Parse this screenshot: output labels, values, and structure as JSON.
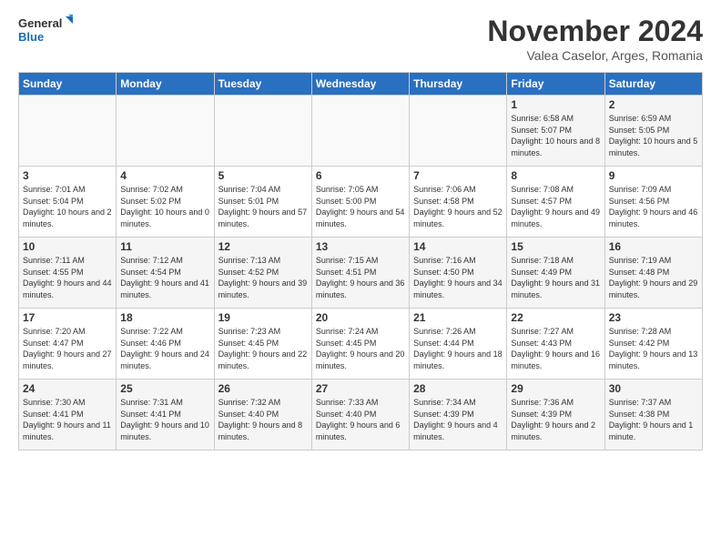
{
  "logo": {
    "text_general": "General",
    "text_blue": "Blue"
  },
  "header": {
    "month_title": "November 2024",
    "location": "Valea Caselor, Arges, Romania"
  },
  "weekdays": [
    "Sunday",
    "Monday",
    "Tuesday",
    "Wednesday",
    "Thursday",
    "Friday",
    "Saturday"
  ],
  "weeks": [
    [
      {
        "day": "",
        "info": ""
      },
      {
        "day": "",
        "info": ""
      },
      {
        "day": "",
        "info": ""
      },
      {
        "day": "",
        "info": ""
      },
      {
        "day": "",
        "info": ""
      },
      {
        "day": "1",
        "info": "Sunrise: 6:58 AM\nSunset: 5:07 PM\nDaylight: 10 hours and 8 minutes."
      },
      {
        "day": "2",
        "info": "Sunrise: 6:59 AM\nSunset: 5:05 PM\nDaylight: 10 hours and 5 minutes."
      }
    ],
    [
      {
        "day": "3",
        "info": "Sunrise: 7:01 AM\nSunset: 5:04 PM\nDaylight: 10 hours and 2 minutes."
      },
      {
        "day": "4",
        "info": "Sunrise: 7:02 AM\nSunset: 5:02 PM\nDaylight: 10 hours and 0 minutes."
      },
      {
        "day": "5",
        "info": "Sunrise: 7:04 AM\nSunset: 5:01 PM\nDaylight: 9 hours and 57 minutes."
      },
      {
        "day": "6",
        "info": "Sunrise: 7:05 AM\nSunset: 5:00 PM\nDaylight: 9 hours and 54 minutes."
      },
      {
        "day": "7",
        "info": "Sunrise: 7:06 AM\nSunset: 4:58 PM\nDaylight: 9 hours and 52 minutes."
      },
      {
        "day": "8",
        "info": "Sunrise: 7:08 AM\nSunset: 4:57 PM\nDaylight: 9 hours and 49 minutes."
      },
      {
        "day": "9",
        "info": "Sunrise: 7:09 AM\nSunset: 4:56 PM\nDaylight: 9 hours and 46 minutes."
      }
    ],
    [
      {
        "day": "10",
        "info": "Sunrise: 7:11 AM\nSunset: 4:55 PM\nDaylight: 9 hours and 44 minutes."
      },
      {
        "day": "11",
        "info": "Sunrise: 7:12 AM\nSunset: 4:54 PM\nDaylight: 9 hours and 41 minutes."
      },
      {
        "day": "12",
        "info": "Sunrise: 7:13 AM\nSunset: 4:52 PM\nDaylight: 9 hours and 39 minutes."
      },
      {
        "day": "13",
        "info": "Sunrise: 7:15 AM\nSunset: 4:51 PM\nDaylight: 9 hours and 36 minutes."
      },
      {
        "day": "14",
        "info": "Sunrise: 7:16 AM\nSunset: 4:50 PM\nDaylight: 9 hours and 34 minutes."
      },
      {
        "day": "15",
        "info": "Sunrise: 7:18 AM\nSunset: 4:49 PM\nDaylight: 9 hours and 31 minutes."
      },
      {
        "day": "16",
        "info": "Sunrise: 7:19 AM\nSunset: 4:48 PM\nDaylight: 9 hours and 29 minutes."
      }
    ],
    [
      {
        "day": "17",
        "info": "Sunrise: 7:20 AM\nSunset: 4:47 PM\nDaylight: 9 hours and 27 minutes."
      },
      {
        "day": "18",
        "info": "Sunrise: 7:22 AM\nSunset: 4:46 PM\nDaylight: 9 hours and 24 minutes."
      },
      {
        "day": "19",
        "info": "Sunrise: 7:23 AM\nSunset: 4:45 PM\nDaylight: 9 hours and 22 minutes."
      },
      {
        "day": "20",
        "info": "Sunrise: 7:24 AM\nSunset: 4:45 PM\nDaylight: 9 hours and 20 minutes."
      },
      {
        "day": "21",
        "info": "Sunrise: 7:26 AM\nSunset: 4:44 PM\nDaylight: 9 hours and 18 minutes."
      },
      {
        "day": "22",
        "info": "Sunrise: 7:27 AM\nSunset: 4:43 PM\nDaylight: 9 hours and 16 minutes."
      },
      {
        "day": "23",
        "info": "Sunrise: 7:28 AM\nSunset: 4:42 PM\nDaylight: 9 hours and 13 minutes."
      }
    ],
    [
      {
        "day": "24",
        "info": "Sunrise: 7:30 AM\nSunset: 4:41 PM\nDaylight: 9 hours and 11 minutes."
      },
      {
        "day": "25",
        "info": "Sunrise: 7:31 AM\nSunset: 4:41 PM\nDaylight: 9 hours and 10 minutes."
      },
      {
        "day": "26",
        "info": "Sunrise: 7:32 AM\nSunset: 4:40 PM\nDaylight: 9 hours and 8 minutes."
      },
      {
        "day": "27",
        "info": "Sunrise: 7:33 AM\nSunset: 4:40 PM\nDaylight: 9 hours and 6 minutes."
      },
      {
        "day": "28",
        "info": "Sunrise: 7:34 AM\nSunset: 4:39 PM\nDaylight: 9 hours and 4 minutes."
      },
      {
        "day": "29",
        "info": "Sunrise: 7:36 AM\nSunset: 4:39 PM\nDaylight: 9 hours and 2 minutes."
      },
      {
        "day": "30",
        "info": "Sunrise: 7:37 AM\nSunset: 4:38 PM\nDaylight: 9 hours and 1 minute."
      }
    ]
  ]
}
